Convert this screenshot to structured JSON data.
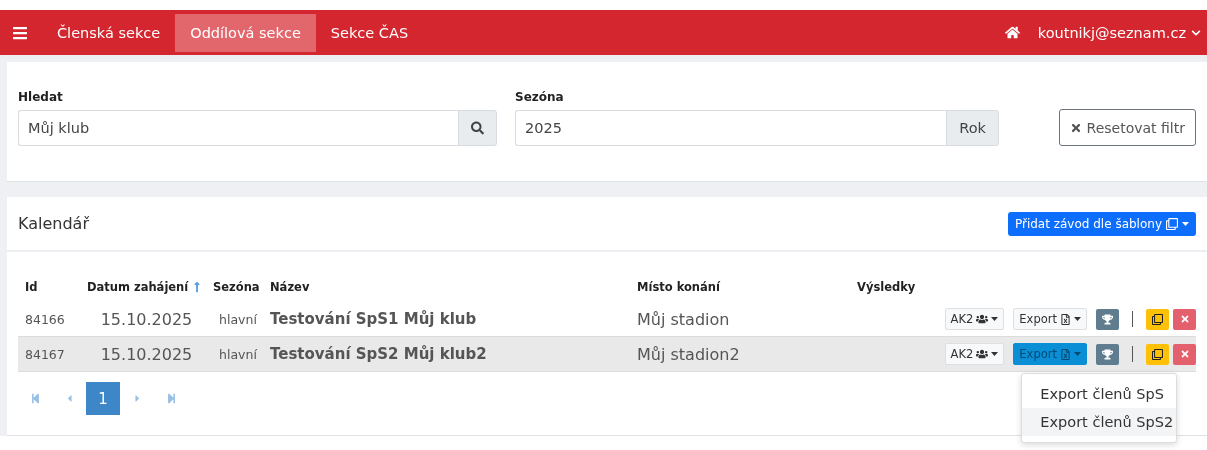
{
  "navbar": {
    "items": [
      {
        "label": "Členská sekce",
        "selected": false
      },
      {
        "label": "Oddílová sekce",
        "selected": true
      },
      {
        "label": "Sekce ČAS",
        "selected": false
      }
    ],
    "user": "koutnikj@seznam.cz"
  },
  "filters": {
    "search": {
      "label": "Hledat",
      "value": "Můj klub"
    },
    "season": {
      "label": "Sezóna",
      "value": "2025",
      "addon": "Rok"
    },
    "reset_button": "Resetovat filtr"
  },
  "calendar": {
    "title": "Kalendář",
    "add_button": "Přidat závod dle šablony",
    "columns": [
      {
        "label": "Id",
        "sorted": false
      },
      {
        "label": "Datum zahájení",
        "sorted": true
      },
      {
        "label": "Sezóna",
        "sorted": false
      },
      {
        "label": "Název",
        "sorted": false
      },
      {
        "label": "Místo konání",
        "sorted": false
      },
      {
        "label": "Výsledky",
        "sorted": false
      }
    ],
    "rows": [
      {
        "id": "84166",
        "date": "15.10.2025",
        "season": "hlavní",
        "name": "Testování SpS1 Můj klub",
        "place": "Můj stadion",
        "category": "AK2",
        "export": "Export",
        "selected": false,
        "export_open": false
      },
      {
        "id": "84167",
        "date": "15.10.2025",
        "season": "hlavní",
        "name": "Testování SpS2 Můj klub2",
        "place": "Můj stadion2",
        "category": "AK2",
        "export": "Export",
        "selected": true,
        "export_open": true
      }
    ],
    "pages": [
      {
        "label": "1",
        "selected": true
      }
    ],
    "export_menu": [
      {
        "label": "Export členů SpS",
        "selected": false
      },
      {
        "label": "Export členů SpS2",
        "selected": true
      }
    ]
  }
}
